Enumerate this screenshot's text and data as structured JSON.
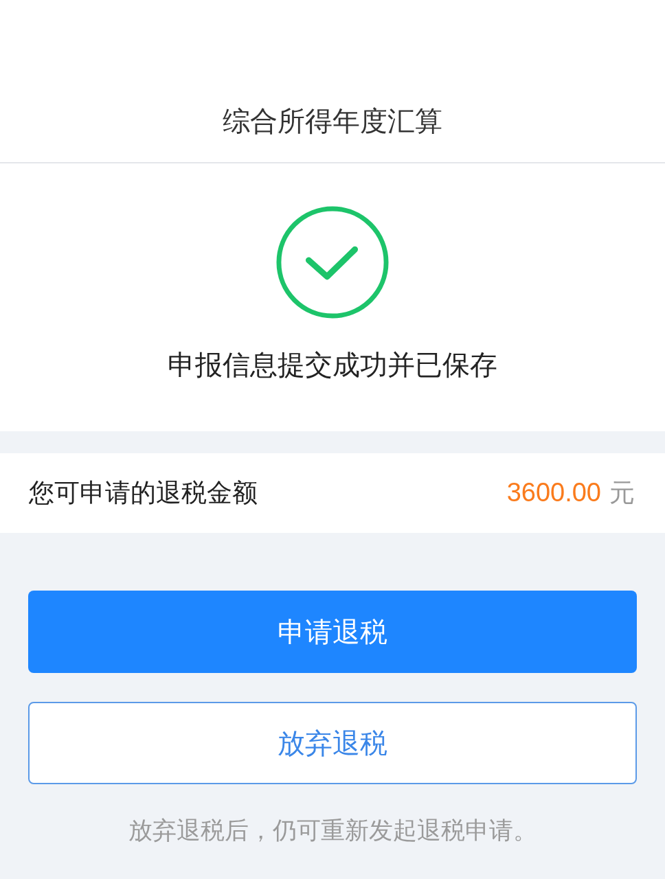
{
  "header": {
    "title": "综合所得年度汇算"
  },
  "result": {
    "kind": "success",
    "message": "申报信息提交成功并已保存"
  },
  "refund": {
    "label": "您可申请的退税金额",
    "amount": "3600.00",
    "unit": "元"
  },
  "buttons": [
    {
      "label": "申请退税",
      "kind": "primary"
    },
    {
      "label": "放弃退税",
      "kind": "outline"
    }
  ],
  "note": "放弃退税后，仍可重新发起退税申请。"
}
